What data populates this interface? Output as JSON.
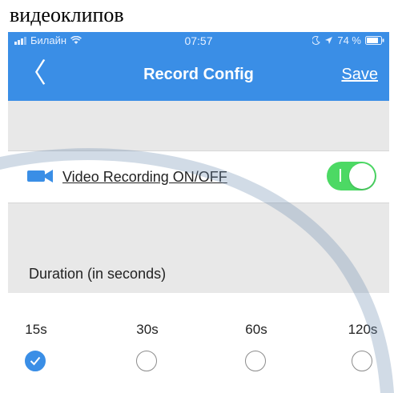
{
  "caption": "видеоклипов",
  "status_bar": {
    "carrier": "Билайн",
    "time": "07:57",
    "battery": "74 %"
  },
  "nav": {
    "title": "Record Config",
    "save_label": "Save"
  },
  "video_row": {
    "label": "Video Recording ON/OFF",
    "toggle_on": true
  },
  "duration": {
    "header": "Duration (in seconds)",
    "options": [
      "15s",
      "30s",
      "60s",
      "120s"
    ],
    "selected": "15s"
  },
  "colors": {
    "accent": "#3a8ee6",
    "toggle_on": "#4cd964",
    "section_bg": "#e8e8e8"
  }
}
